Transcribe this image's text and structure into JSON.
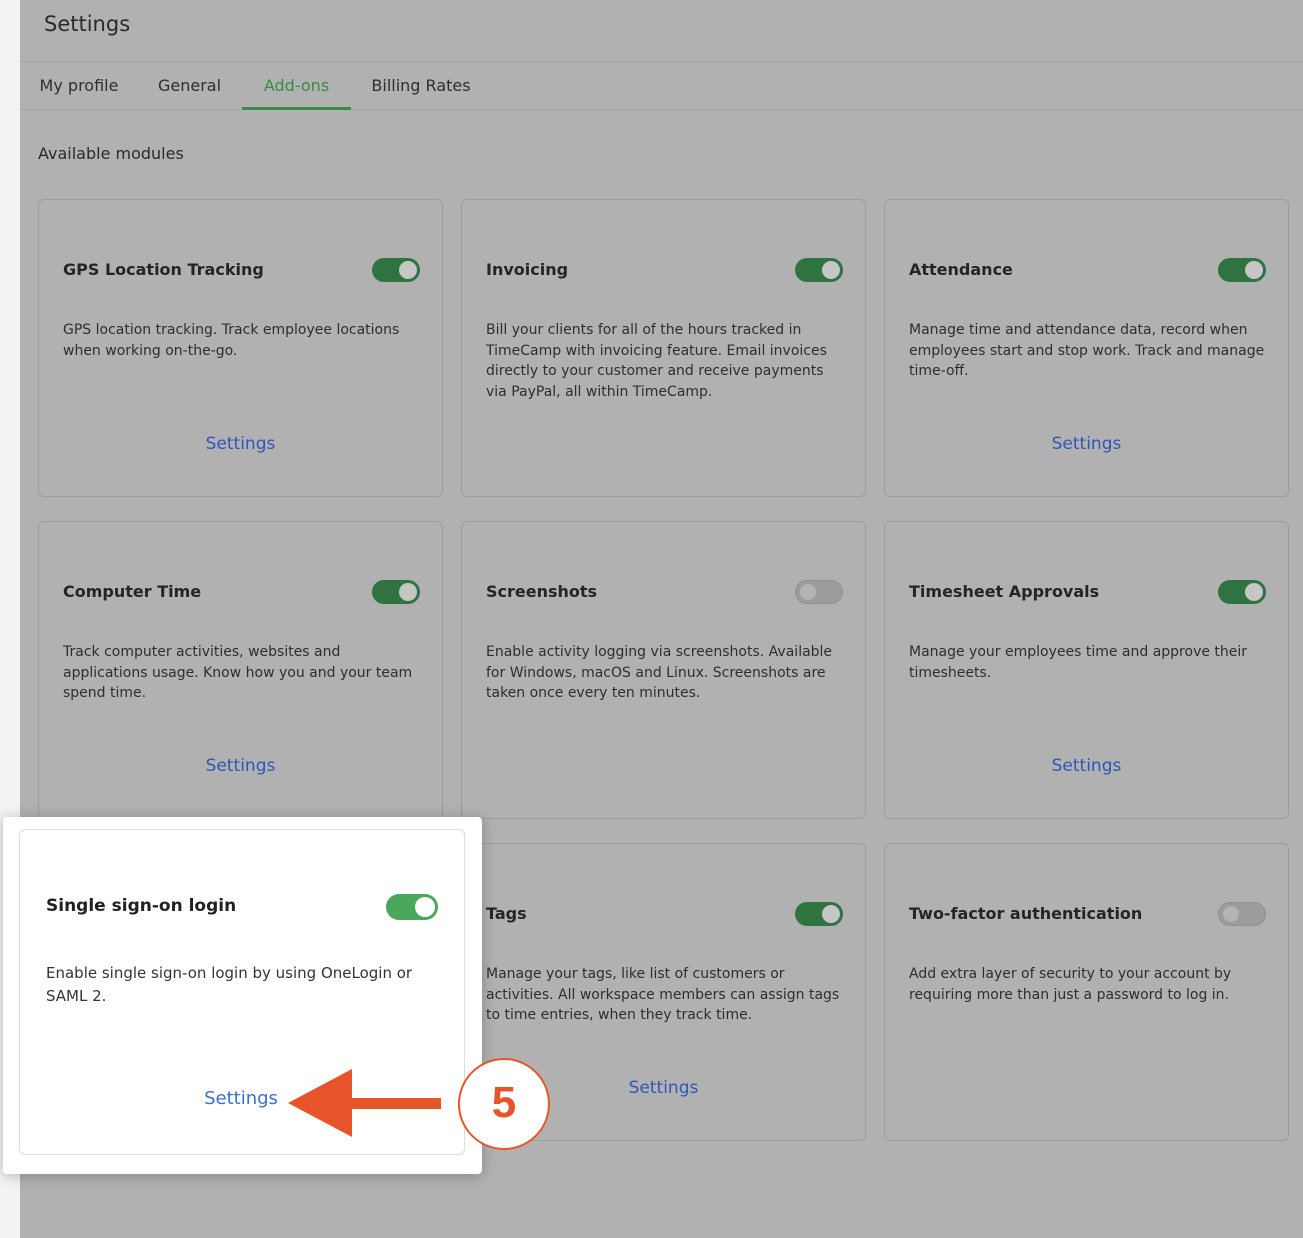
{
  "header": {
    "title": "Settings"
  },
  "tabs": [
    {
      "label": "My profile",
      "active": false
    },
    {
      "label": "General",
      "active": false
    },
    {
      "label": "Add-ons",
      "active": true
    },
    {
      "label": "Billing Rates",
      "active": false
    }
  ],
  "section_title": "Available modules",
  "modules": [
    {
      "title": "GPS Location Tracking",
      "enabled": true,
      "description": "GPS location tracking. Track employee locations when working on-the-go.",
      "settings_label": "Settings"
    },
    {
      "title": "Invoicing",
      "enabled": true,
      "description": "Bill your clients for all of the hours tracked in TimeCamp with invoicing feature. Email invoices directly to your customer and receive payments via PayPal, all within TimeCamp.",
      "settings_label": ""
    },
    {
      "title": "Attendance",
      "enabled": true,
      "description": "Manage time and attendance data, record when employees start and stop work. Track and manage time-off.",
      "settings_label": "Settings"
    },
    {
      "title": "Computer Time",
      "enabled": true,
      "description": "Track computer activities, websites and applications usage. Know how you and your team spend time.",
      "settings_label": "Settings"
    },
    {
      "title": "Screenshots",
      "enabled": false,
      "description": "Enable activity logging via screenshots. Available for Windows, macOS and Linux. Screenshots are taken once every ten minutes.",
      "settings_label": ""
    },
    {
      "title": "Timesheet Approvals",
      "enabled": true,
      "description": "Manage your employees time and approve their timesheets.",
      "settings_label": "Settings"
    },
    {
      "title": "Single sign-on login",
      "enabled": true,
      "description": "Enable single sign-on login by using OneLogin or SAML 2.",
      "settings_label": "Settings"
    },
    {
      "title": "Tags",
      "enabled": true,
      "description": "Manage your tags, like list of customers or activities. All workspace members can assign tags to time entries, when they track time.",
      "settings_label": "Settings"
    },
    {
      "title": "Two-factor authentication",
      "enabled": false,
      "description": "Add extra layer of security to your account by requiring more than just a password to log in.",
      "settings_label": ""
    }
  ],
  "callout": {
    "step_number": "5",
    "color": "#e8542a"
  },
  "colors": {
    "accent_green": "#4aa85c",
    "link_blue": "#3b6fd6"
  }
}
